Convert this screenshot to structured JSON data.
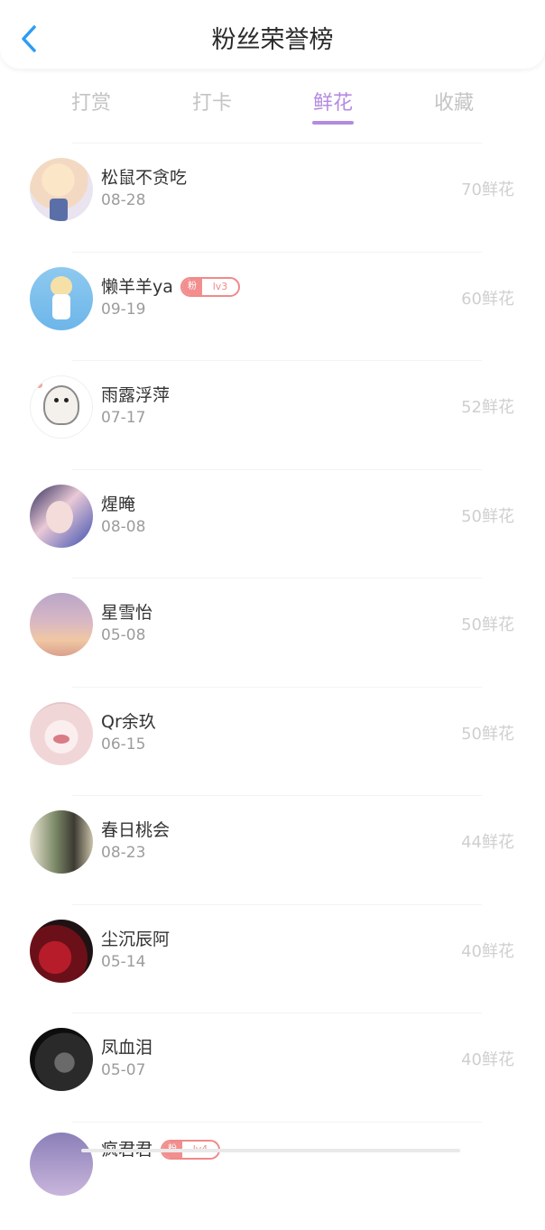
{
  "header": {
    "title": "粉丝荣誉榜",
    "back_icon": "chevron-left-icon",
    "accent": "#2d9cf3"
  },
  "tabs": [
    {
      "label": "打赏",
      "active": false
    },
    {
      "label": "打卡",
      "active": false
    },
    {
      "label": "鲜花",
      "active": true
    },
    {
      "label": "收藏",
      "active": false
    }
  ],
  "colors": {
    "active_tab": "#b48be0",
    "badge": "#f08a8a",
    "amount": "#cfcfcf"
  },
  "fans": [
    {
      "name": "松鼠不贪吃",
      "date": "08-28",
      "amount": "70鲜花",
      "badge": null
    },
    {
      "name": "懒羊羊ya",
      "date": "09-19",
      "amount": "60鲜花",
      "badge": {
        "prefix": "粉",
        "level": "lv3"
      }
    },
    {
      "name": "雨露浮萍",
      "date": "07-17",
      "amount": "52鲜花",
      "badge": null
    },
    {
      "name": "煋晻",
      "date": "08-08",
      "amount": "50鲜花",
      "badge": null
    },
    {
      "name": "星雪怡",
      "date": "05-08",
      "amount": "50鲜花",
      "badge": null
    },
    {
      "name": "Qr余玖",
      "date": "06-15",
      "amount": "50鲜花",
      "badge": null
    },
    {
      "name": "春日桃会",
      "date": "08-23",
      "amount": "44鲜花",
      "badge": null
    },
    {
      "name": "尘沉辰阿",
      "date": "05-14",
      "amount": "40鲜花",
      "badge": null
    },
    {
      "name": "凤血泪",
      "date": "05-07",
      "amount": "40鲜花",
      "badge": null
    },
    {
      "name": "疯君君",
      "date": "",
      "amount": "",
      "badge": {
        "prefix": "粉",
        "level": "lv4"
      }
    }
  ]
}
